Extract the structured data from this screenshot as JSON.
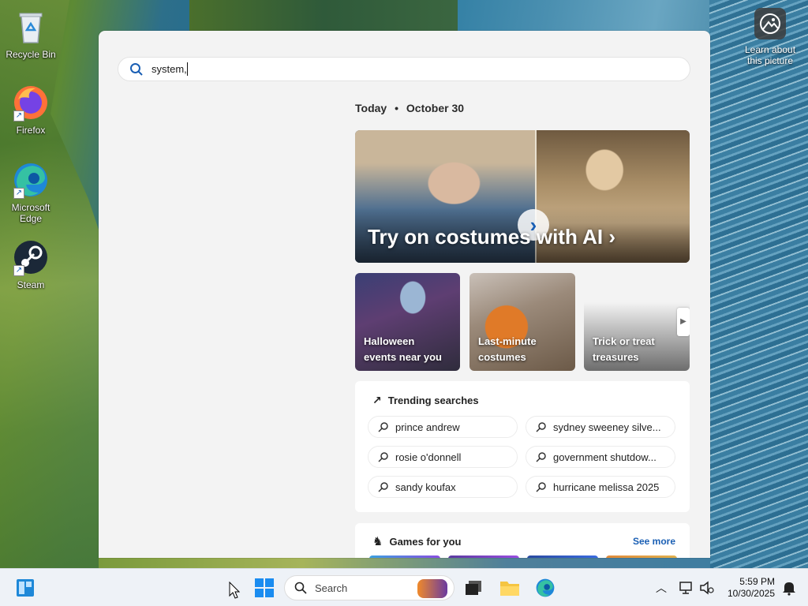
{
  "desktop": {
    "icons": [
      {
        "label": "Recycle Bin"
      },
      {
        "label": "Firefox"
      },
      {
        "label": "Microsoft Edge"
      },
      {
        "label": "Steam"
      }
    ],
    "learn_picture": "Learn about this picture"
  },
  "search_panel": {
    "query": "system,",
    "today_label": "Today",
    "today_date": "October 30",
    "hero_title": "Try on costumes with AI",
    "cards": [
      {
        "label_line1": "Halloween",
        "label_line2": "events near you"
      },
      {
        "label_line1": "Last-minute",
        "label_line2": "costumes"
      },
      {
        "label_line1": "Trick or treat",
        "label_line2": "treasures"
      }
    ],
    "trending": {
      "title": "Trending searches",
      "items": [
        "prince andrew",
        "sydney sweeney silve...",
        "rosie o'donnell",
        "government shutdow...",
        "sandy koufax",
        "hurricane melissa 2025"
      ]
    },
    "games": {
      "title": "Games for you",
      "see_more": "See more"
    }
  },
  "taskbar": {
    "search_placeholder": "Search",
    "time": "5:59 PM",
    "date": "10/30/2025"
  },
  "colors": {
    "accent": "#1a5fb4",
    "panel_bg": "#f3f3f3",
    "taskbar_bg": "#eef2f7"
  }
}
